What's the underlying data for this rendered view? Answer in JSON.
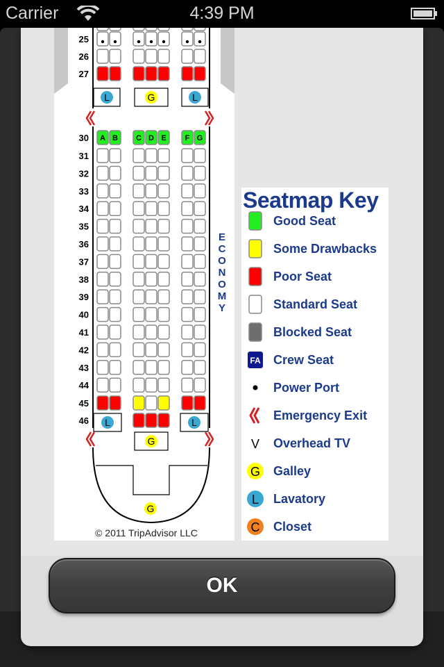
{
  "status_bar": {
    "carrier": "Carrier",
    "time": "4:39 PM",
    "wifi_icon": "wifi-icon",
    "battery_icon": "battery-icon"
  },
  "seatmap": {
    "rows_top": [
      {
        "row": "25",
        "left": [
          "standard-power",
          "standard-power"
        ],
        "center": [
          "standard-power",
          "standard-power",
          "standard-power"
        ],
        "right": [
          "standard-power",
          "standard-power"
        ]
      },
      {
        "row": "26",
        "left": [
          "standard",
          "standard"
        ],
        "center": [
          "standard",
          "standard",
          "standard"
        ],
        "right": [
          "standard",
          "standard"
        ]
      },
      {
        "row": "27",
        "left": [
          "poor",
          "poor"
        ],
        "center": [
          "poor",
          "poor",
          "poor"
        ],
        "right": [
          "poor",
          "poor"
        ]
      }
    ],
    "facilities_mid": {
      "left": "L",
      "center": "G",
      "right": "L"
    },
    "header_row": {
      "row": "30",
      "letters": [
        "A",
        "B",
        "C",
        "D",
        "E",
        "F",
        "G"
      ],
      "status": "good"
    },
    "standard_rows": [
      "31",
      "32",
      "33",
      "34",
      "35",
      "36",
      "37",
      "38",
      "39",
      "40",
      "41",
      "42",
      "43",
      "44"
    ],
    "row_45": {
      "row": "45",
      "left": [
        "poor",
        "poor"
      ],
      "center": [
        "drawback",
        "standard",
        "drawback"
      ],
      "right": [
        "poor",
        "poor"
      ]
    },
    "row_46": {
      "row": "46",
      "left_facility": "L",
      "center": [
        "poor",
        "poor",
        "poor"
      ],
      "right_facility": "L"
    },
    "rear_galley": "G",
    "tail_galley": "G",
    "cabin_label": "ECONOMY",
    "copyright": "© 2011 TripAdvisor LLC",
    "colors": {
      "good": "#22ee22",
      "drawback": "#ffff00",
      "poor": "#ff0000",
      "standard": "#ffffff",
      "blocked": "#6e6e6e",
      "exit": "#d42020",
      "galley": "#ffff00",
      "lavatory": "#3ba8d4",
      "closet": "#f08020"
    }
  },
  "key": {
    "title": "Seatmap Key",
    "items": [
      {
        "label": "Good Seat",
        "icon": "good-seat-icon"
      },
      {
        "label": "Some Drawbacks",
        "icon": "drawback-seat-icon"
      },
      {
        "label": "Poor Seat",
        "icon": "poor-seat-icon"
      },
      {
        "label": "Standard Seat",
        "icon": "standard-seat-icon"
      },
      {
        "label": "Blocked Seat",
        "icon": "blocked-seat-icon"
      },
      {
        "label": "Crew Seat",
        "icon": "crew-seat-icon",
        "glyph": "FA"
      },
      {
        "label": "Power Port",
        "icon": "power-port-icon"
      },
      {
        "label": "Emergency Exit",
        "icon": "emergency-exit-icon"
      },
      {
        "label": "Overhead TV",
        "icon": "overhead-tv-icon",
        "glyph": "V"
      },
      {
        "label": "Galley",
        "icon": "galley-icon",
        "glyph": "G"
      },
      {
        "label": "Lavatory",
        "icon": "lavatory-icon",
        "glyph": "L"
      },
      {
        "label": "Closet",
        "icon": "closet-icon",
        "glyph": "C"
      }
    ]
  },
  "ok_button": {
    "label": "OK"
  }
}
